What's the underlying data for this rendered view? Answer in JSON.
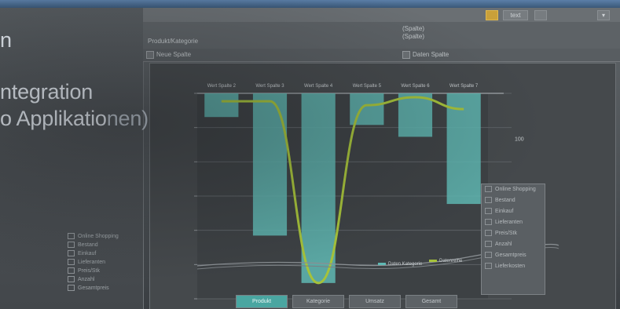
{
  "title": {
    "line1": "n",
    "line2": "ntegration",
    "line3_pre": "o Applikatio",
    "line3_post": "nen)"
  },
  "toolbar": {
    "btn1": "",
    "btn2": "text",
    "btn3": "",
    "btn4": "▾"
  },
  "header": {
    "col1": "Produkt/Kategorie",
    "col2a": "(Spalte)",
    "col2b": "(Spalte)"
  },
  "subrow": {
    "left": "Neue Spalte",
    "right": "Daten Spalte"
  },
  "chart_data": {
    "type": "bar",
    "categories": [
      "",
      "",
      "",
      "",
      "",
      ""
    ],
    "series": [
      {
        "values": [
          -30,
          -180,
          -240,
          -40,
          -55,
          -140
        ]
      },
      {
        "values": [
          -10,
          -10,
          -240,
          -15,
          -5,
          -20
        ]
      }
    ],
    "top_labels": [
      "Wert Spalte 2",
      "Wert Spalte 3",
      "Wert Spalte 4",
      "Wert Spalte 5",
      "Wert Spalte 6",
      "Wert Spalte 7"
    ],
    "ylim": [
      -260,
      0
    ],
    "right_tick": "100",
    "legend_series": [
      "Daten Kategorie",
      "Datenreihe"
    ]
  },
  "legend": {
    "items": [
      "Online Shopping",
      "Bestand",
      "Einkauf",
      "Lieferanten",
      "Preis/Stk",
      "Anzahl",
      "Gesamtpreis",
      "Lieferkosten"
    ]
  },
  "left_list": {
    "items": [
      "Online Shopping",
      "Bestand",
      "Einkauf",
      "Lieferanten",
      "Preis/Stk",
      "Anzahl",
      "Gesamtpreis"
    ]
  },
  "tabs": [
    "Produkt",
    "Kategorie",
    "Umsatz",
    "Gesamt"
  ],
  "colors": {
    "bar": "#5fb8b3",
    "line": "#a6c23a",
    "accent": "#f0c040"
  }
}
